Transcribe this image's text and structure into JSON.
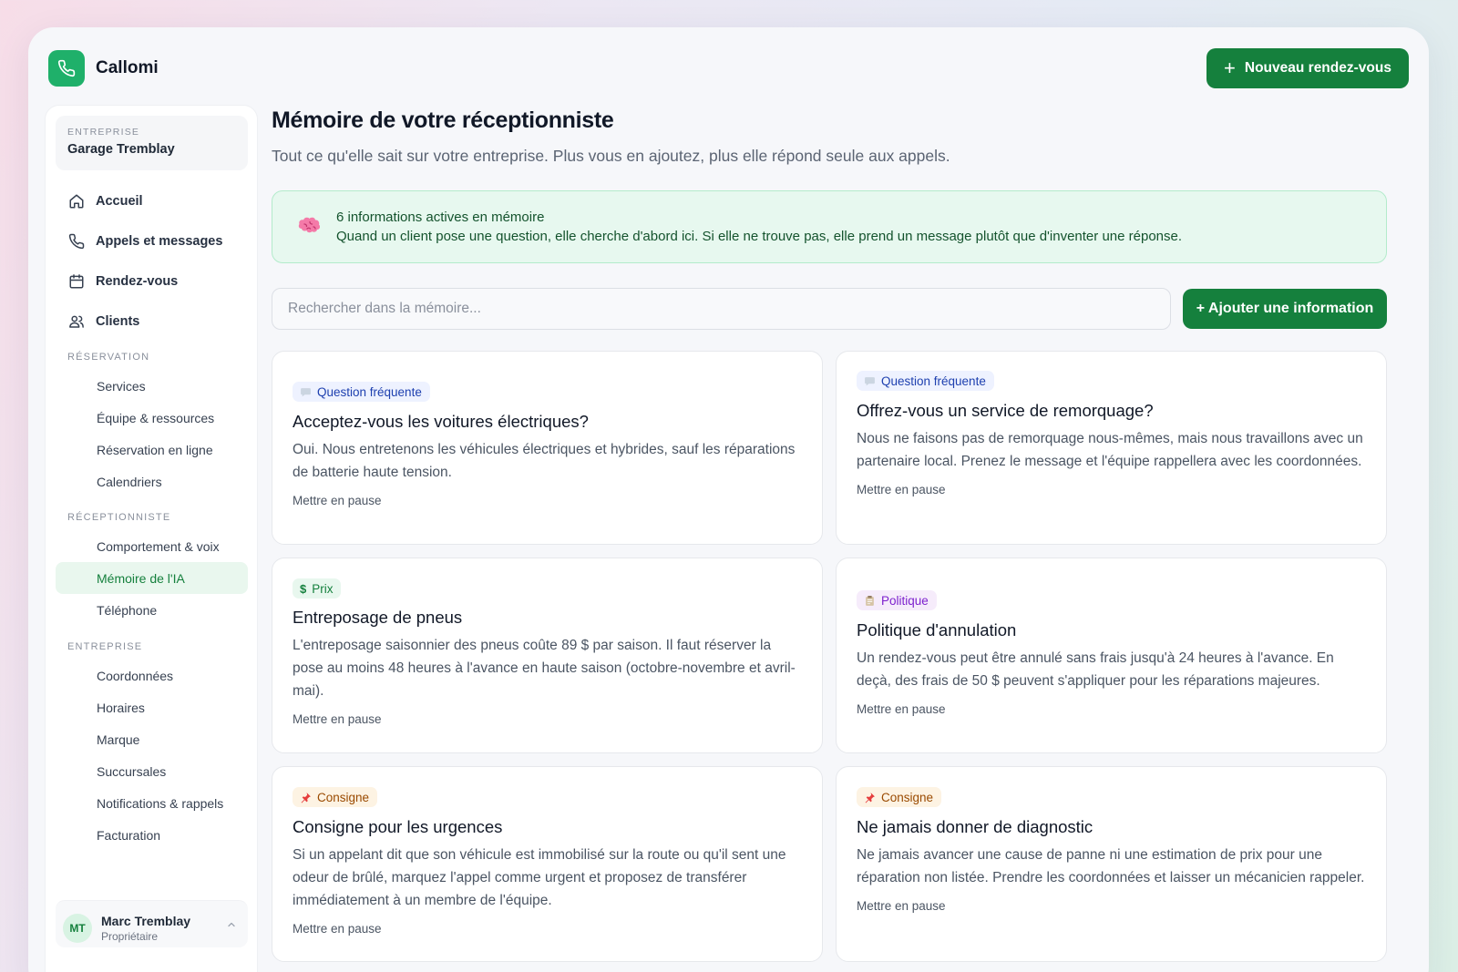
{
  "brand": {
    "name": "Callomi",
    "logo_icon": "phone-icon",
    "accent": "#1fb06a"
  },
  "header": {
    "new_button": "Nouveau rendez-vous"
  },
  "sidebar": {
    "company_label": "ENTREPRISE",
    "company_name": "Garage Tremblay",
    "main_items": [
      {
        "label": "Accueil",
        "icon": "home-icon"
      },
      {
        "label": "Appels et messages",
        "icon": "phone-icon"
      },
      {
        "label": "Rendez-vous",
        "icon": "calendar-icon"
      },
      {
        "label": "Clients",
        "icon": "users-icon"
      }
    ],
    "sections": [
      {
        "title": "RÉSERVATION",
        "items": [
          "Services",
          "Équipe & ressources",
          "Réservation en ligne",
          "Calendriers"
        ]
      },
      {
        "title": "RÉCEPTIONNISTE",
        "items": [
          "Comportement & voix",
          "Mémoire de l'IA",
          "Téléphone"
        ]
      },
      {
        "title": "ENTREPRISE",
        "items": [
          "Coordonnées",
          "Horaires",
          "Marque",
          "Succursales",
          "Notifications & rappels",
          "Facturation"
        ]
      }
    ],
    "active_item": "Mémoire de l'IA",
    "user": {
      "initials": "MT",
      "name": "Marc Tremblay",
      "role": "Propriétaire"
    }
  },
  "main": {
    "title": "Mémoire de votre réceptionniste",
    "subtitle": "Tout ce qu'elle sait sur votre entreprise. Plus vous en ajoutez, plus elle répond seule aux appels.",
    "banner": {
      "icon": "brain-icon",
      "line1": "6 informations actives en mémoire",
      "line2": "Quand un client pose une question, elle cherche d'abord ici. Si elle ne trouve pas, elle prend un message plutôt que d'inventer une réponse."
    },
    "search_placeholder": "Rechercher dans la mémoire...",
    "add_button": "+ Ajouter une information",
    "cards": [
      {
        "tag": "Question fréquente",
        "tag_type": "faq",
        "tag_icon": "speech-bubble-icon",
        "title": "Acceptez-vous les voitures électriques?",
        "body": "Oui. Nous entretenons les véhicules électriques et hybrides, sauf les réparations de batterie haute tension.",
        "action": "Mettre en pause"
      },
      {
        "tag": "Question fréquente",
        "tag_type": "faq",
        "tag_icon": "speech-bubble-icon",
        "title": "Offrez-vous un service de remorquage?",
        "body": "Nous ne faisons pas de remorquage nous-mêmes, mais nous travaillons avec un partenaire local. Prenez le message et l'équipe rappellera avec les coordonnées.",
        "action": "Mettre en pause"
      },
      {
        "tag": "Prix",
        "tag_type": "prix",
        "tag_icon": "dollar-icon",
        "title": "Entreposage de pneus",
        "body": "L'entreposage saisonnier des pneus coûte 89 $ par saison. Il faut réserver la pose au moins 48 heures à l'avance en haute saison (octobre-novembre et avril-mai).",
        "action": "Mettre en pause"
      },
      {
        "tag": "Politique",
        "tag_type": "pol",
        "tag_icon": "clipboard-icon",
        "title": "Politique d'annulation",
        "body": "Un rendez-vous peut être annulé sans frais jusqu'à 24 heures à l'avance. En deçà, des frais de 50 $ peuvent s'appliquer pour les réparations majeures.",
        "action": "Mettre en pause"
      },
      {
        "tag": "Consigne",
        "tag_type": "cons",
        "tag_icon": "pin-icon",
        "title": "Consigne pour les urgences",
        "body": "Si un appelant dit que son véhicule est immobilisé sur la route ou qu'il sent une odeur de brûlé, marquez l'appel comme urgent et proposez de transférer immédiatement à un membre de l'équipe.",
        "action": "Mettre en pause"
      },
      {
        "tag": "Consigne",
        "tag_type": "cons",
        "tag_icon": "pin-icon",
        "title": "Ne jamais donner de diagnostic",
        "body": "Ne jamais avancer une cause de panne ni une estimation de prix pour une réparation non listée. Prendre les coordonnées et laisser un mécanicien rappeler.",
        "action": "Mettre en pause"
      }
    ]
  }
}
